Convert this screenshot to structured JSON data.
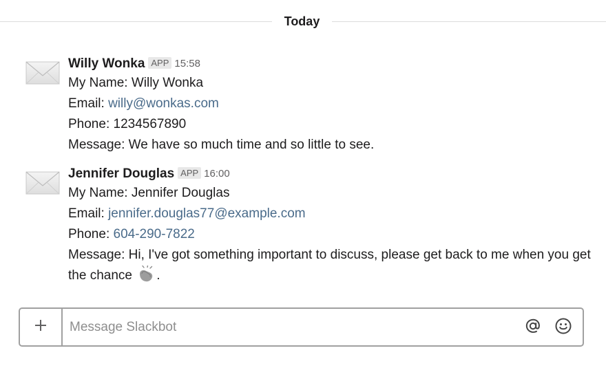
{
  "divider": {
    "label": "Today"
  },
  "messages": [
    {
      "sender": "Willy Wonka",
      "badge": "APP",
      "time": "15:58",
      "avatar_icon": "envelope-icon",
      "name_label": "My Name:",
      "name_value": "Willy Wonka",
      "email_label": "Email:",
      "email_value": "willy@wonkas.com",
      "phone_label": "Phone:",
      "phone_value": "1234567890",
      "message_label": "Message:",
      "message_value": "We have so much time and so little to see."
    },
    {
      "sender": "Jennifer Douglas",
      "badge": "APP",
      "time": "16:00",
      "avatar_icon": "envelope-icon",
      "name_label": "My Name:",
      "name_value": "Jennifer Douglas",
      "email_label": "Email:",
      "email_value": "jennifer.douglas77@example.com",
      "phone_label": "Phone:",
      "phone_value": "604-290-7822",
      "message_label": "Message:",
      "message_value": "Hi, I've got something important to discuss, please get back to me when you get the chance",
      "message_suffix": ".",
      "emoji_icon": "clapping-hands-icon"
    }
  ],
  "composer": {
    "placeholder": "Message Slackbot",
    "add_icon": "plus-icon",
    "mention_icon": "at-sign-icon",
    "emoji_icon": "smiley-face-icon"
  },
  "colors": {
    "link": "#4a6b8a",
    "badge_bg": "#e8e8e8",
    "border": "#a0a0a0"
  }
}
